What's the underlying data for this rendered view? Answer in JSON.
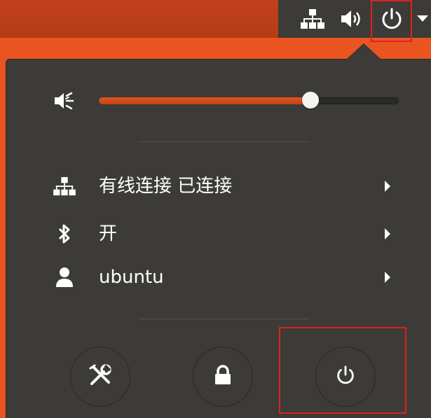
{
  "topbar": {
    "icons": [
      "network-wired-icon",
      "volume-high-icon",
      "power-icon",
      "chevron-down-icon"
    ]
  },
  "volume": {
    "icon": "volume-low-icon",
    "level": 0.705
  },
  "rows": [
    {
      "icon": "network-wired-icon",
      "label": "有线连接 已连接"
    },
    {
      "icon": "bluetooth-icon",
      "label": "开"
    },
    {
      "icon": "user-icon",
      "label": "ubuntu"
    }
  ],
  "buttons": [
    {
      "icon": "settings-tools-icon"
    },
    {
      "icon": "lock-icon"
    },
    {
      "icon": "power-icon"
    }
  ],
  "colors": {
    "accent": "#e95420",
    "panel": "#3c3b37",
    "highlight": "#e02020"
  }
}
